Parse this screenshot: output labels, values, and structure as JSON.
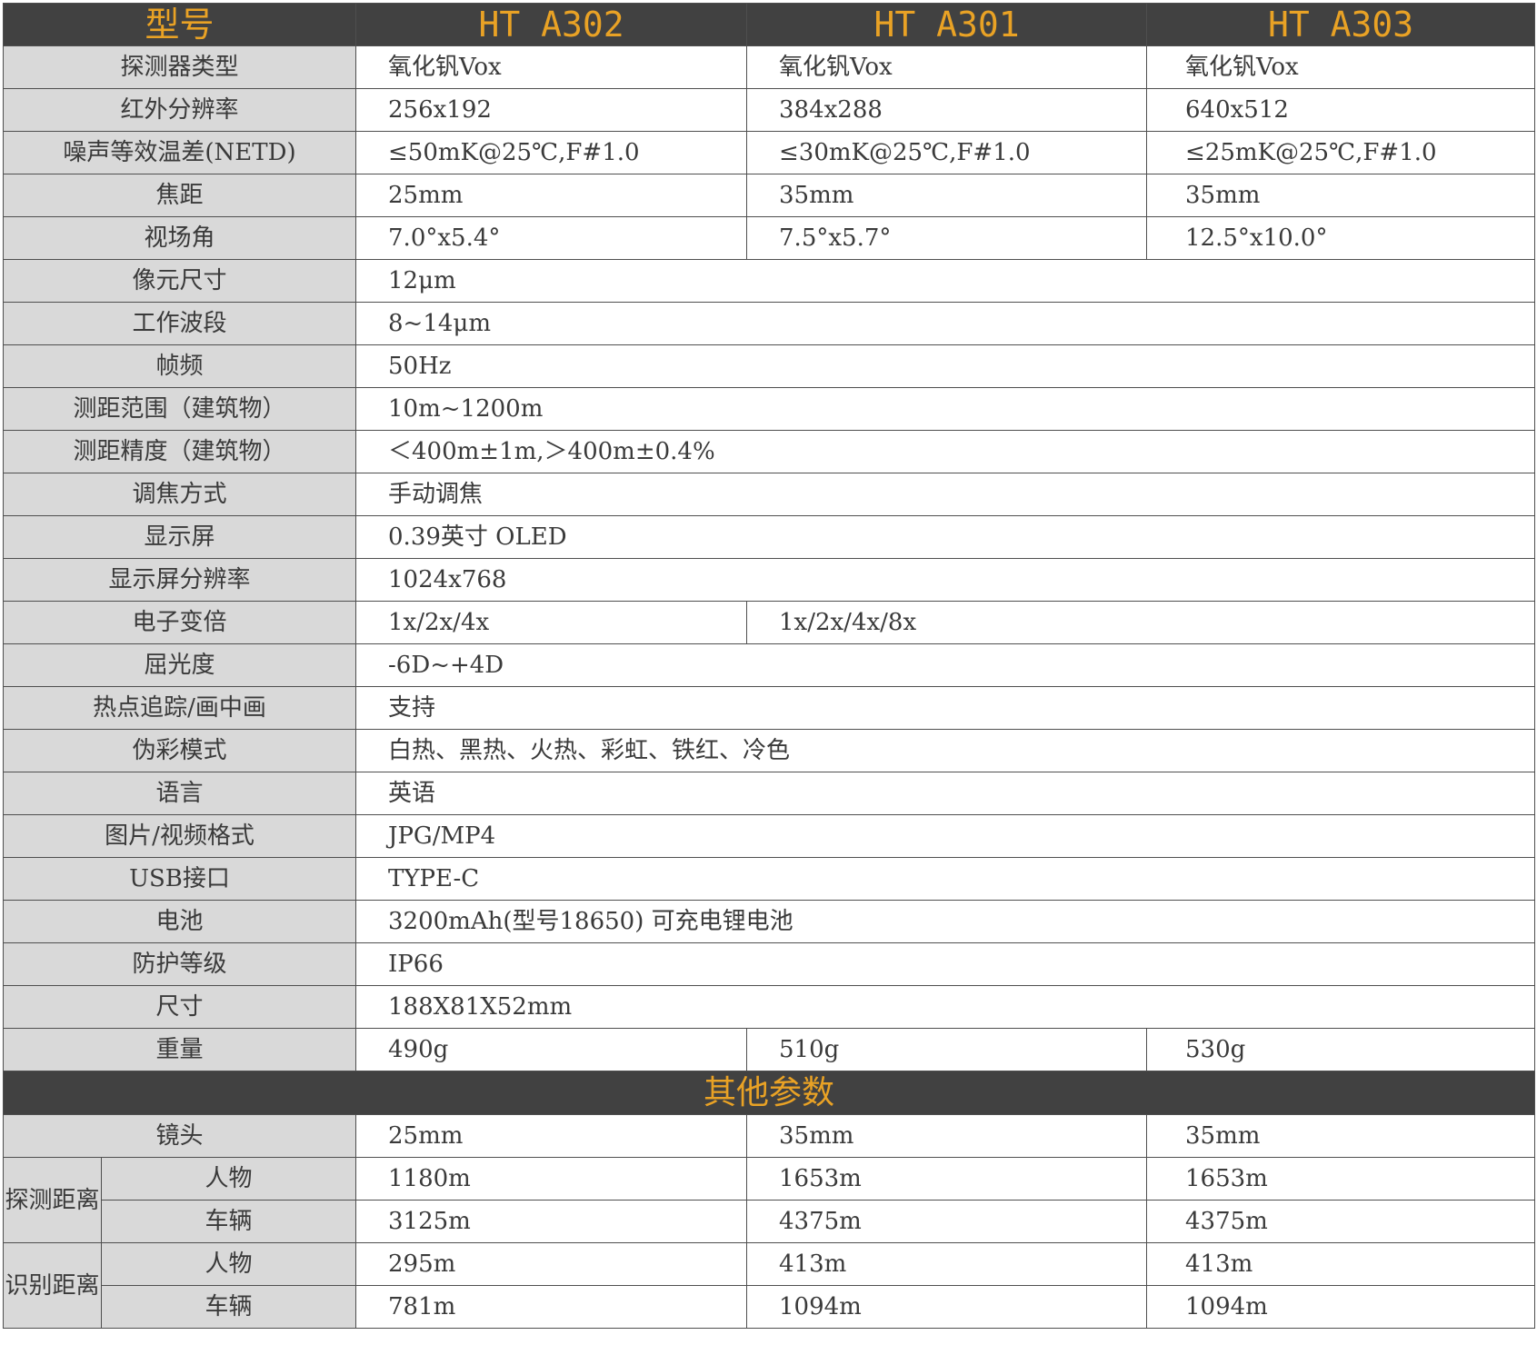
{
  "header": {
    "label": "型号",
    "models": [
      "HT A302",
      "HT A301",
      "HT A303"
    ]
  },
  "specs": {
    "detector": {
      "label": "探测器类型",
      "values": [
        "氧化钒Vox",
        "氧化钒Vox",
        "氧化钒Vox"
      ]
    },
    "ir_resolution": {
      "label": "红外分辨率",
      "values": [
        "256x192",
        "384x288",
        "640x512"
      ]
    },
    "netd": {
      "label": "噪声等效温差(NETD)",
      "values": [
        "≤50mK@25℃,F#1.0",
        "≤30mK@25℃,F#1.0",
        "≤25mK@25℃,F#1.0"
      ]
    },
    "focal": {
      "label": "焦距",
      "values": [
        "25mm",
        "35mm",
        "35mm"
      ]
    },
    "fov": {
      "label": "视场角",
      "values": [
        "7.0°x5.4°",
        "7.5°x5.7°",
        "12.5°x10.0°"
      ]
    },
    "pixel": {
      "label": "像元尺寸",
      "value": "12μm"
    },
    "band": {
      "label": "工作波段",
      "value": "8~14μm"
    },
    "frame": {
      "label": "帧频",
      "value": "50Hz"
    },
    "range": {
      "label": "测距范围（建筑物）",
      "value": "10m~1200m"
    },
    "accuracy": {
      "label": "测距精度（建筑物）",
      "value": "＜400m±1m,＞400m±0.4%"
    },
    "focus": {
      "label": "调焦方式",
      "value": "手动调焦"
    },
    "display": {
      "label": "显示屏",
      "value": "0.39英寸 OLED"
    },
    "display_res": {
      "label": "显示屏分辨率",
      "value": "1024x768"
    },
    "zoom": {
      "label": "电子变倍",
      "values": [
        "1x/2x/4x",
        "1x/2x/4x/8x"
      ]
    },
    "diopter": {
      "label": "屈光度",
      "value": "-6D~+4D"
    },
    "hotspot": {
      "label": "热点追踪/画中画",
      "value": "支持"
    },
    "palette": {
      "label": "伪彩模式",
      "value": "白热、黑热、火热、彩虹、铁红、冷色"
    },
    "language": {
      "label": "语言",
      "value": "英语"
    },
    "format": {
      "label": "图片/视频格式",
      "value": "JPG/MP4"
    },
    "usb": {
      "label": "USB接口",
      "value": "TYPE-C"
    },
    "battery": {
      "label": "电池",
      "value": "3200mAh(型号18650) 可充电锂电池"
    },
    "protection": {
      "label": "防护等级",
      "value": "IP66"
    },
    "size": {
      "label": "尺寸",
      "value": "188X81X52mm"
    },
    "weight": {
      "label": "重量",
      "values": [
        "490g",
        "510g",
        "530g"
      ]
    }
  },
  "other": {
    "title": "其他参数",
    "lens": {
      "label": "镜头",
      "values": [
        "25mm",
        "35mm",
        "35mm"
      ]
    },
    "detect": {
      "label": "探测距离",
      "person": {
        "label": "人物",
        "values": [
          "1180m",
          "1653m",
          "1653m"
        ]
      },
      "vehicle": {
        "label": "车辆",
        "values": [
          "3125m",
          "4375m",
          "4375m"
        ]
      }
    },
    "recognize": {
      "label": "识别距离",
      "person": {
        "label": "人物",
        "values": [
          "295m",
          "413m",
          "413m"
        ]
      },
      "vehicle": {
        "label": "车辆",
        "values": [
          "781m",
          "1094m",
          "1094m"
        ]
      }
    }
  },
  "colors": {
    "header_bg": "#414141",
    "accent": "#e9a225",
    "label_bg": "#d9d9d9",
    "border": "#4f4f4f"
  }
}
